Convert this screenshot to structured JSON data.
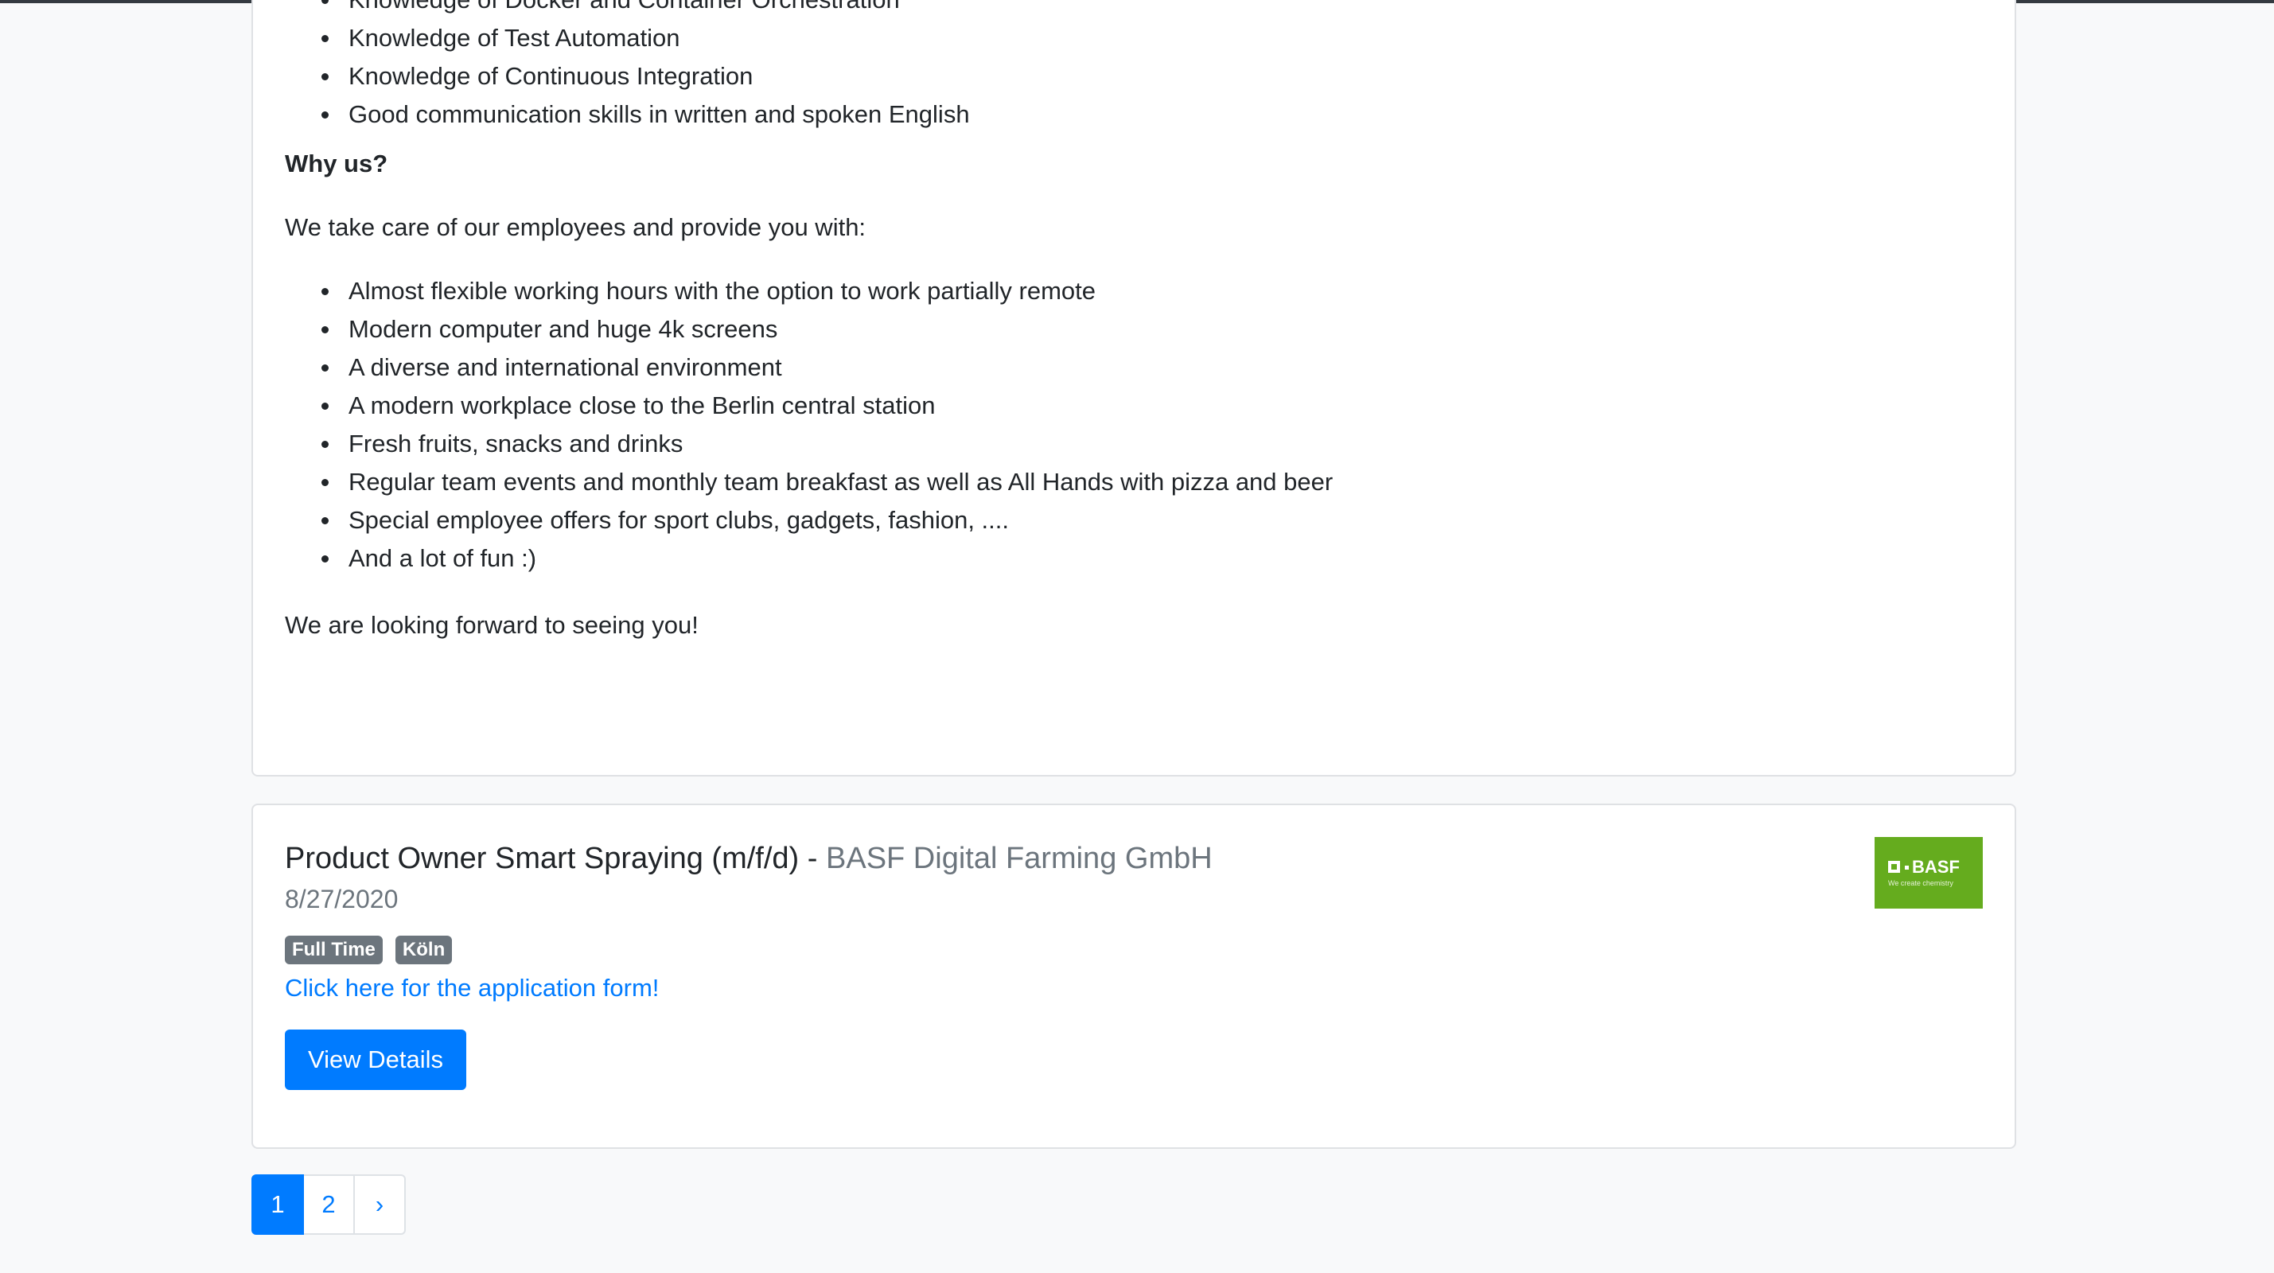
{
  "previous_job_description": {
    "skills_list": [
      "Knowledge of Docker and Container Orchestration",
      "Knowledge of Test Automation",
      "Knowledge of Continuous Integration",
      "Good communication skills in written and spoken English"
    ],
    "why_us_heading": "Why us?",
    "benefits_intro": "We take care of our employees and provide you with:",
    "benefits_list": [
      "Almost flexible working hours with the option to work partially remote",
      "Modern computer and huge 4k screens",
      "A diverse and international environment",
      "A modern workplace close to the Berlin central station",
      "Fresh fruits, snacks and drinks",
      "Regular team events and monthly team breakfast as well as All Hands with pizza and beer",
      "Special employee offers for sport clubs, gadgets, fashion, ....",
      "And a lot of fun :)"
    ],
    "closing": "We are looking forward to seeing you!"
  },
  "job_card": {
    "title": "Product Owner Smart Spraying (m/f/d)",
    "separator": " - ",
    "company": "BASF Digital Farming GmbH",
    "date": "8/27/2020",
    "badges": [
      "Full Time",
      "Köln"
    ],
    "apply_link": "Click here for the application form!",
    "details_button": "View Details",
    "logo": {
      "wordmark": "BASF",
      "tagline": "We create chemistry",
      "color": "#65ac1e"
    }
  },
  "pagination": {
    "pages": [
      "1",
      "2"
    ],
    "next": "›",
    "active_page": "1"
  },
  "colors": {
    "primary": "#007bff",
    "badge": "#6c757d",
    "muted_text": "#6c757d",
    "background": "#f8f9fa"
  }
}
